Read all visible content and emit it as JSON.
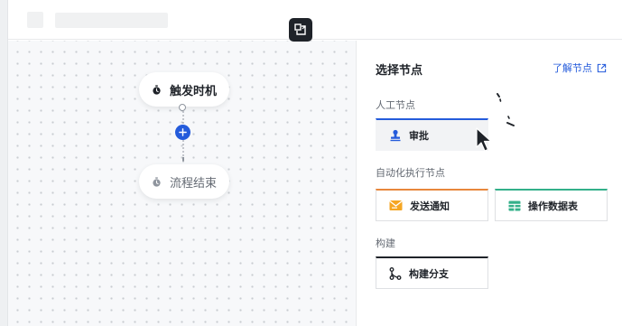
{
  "canvas": {
    "trigger_node": {
      "label": "触发时机",
      "icon": "stopwatch-icon"
    },
    "end_node": {
      "label": "流程结束",
      "icon": "stopwatch-icon"
    },
    "add_button": {
      "icon": "plus-icon"
    }
  },
  "topbar": {
    "expand_icon": "collapse-expand-icon"
  },
  "panel": {
    "title": "选择节点",
    "learn_link": "了解节点",
    "sections": {
      "manual": {
        "title": "人工节点",
        "items": [
          {
            "label": "审批",
            "icon": "stamp-icon",
            "accent": "#245bdb"
          }
        ]
      },
      "automation": {
        "title": "自动化执行节点",
        "items": [
          {
            "label": "发送通知",
            "icon": "mail-notify-icon",
            "accent": "#e8873c"
          },
          {
            "label": "操作数据表",
            "icon": "table-icon",
            "accent": "#33b08a"
          }
        ]
      },
      "build": {
        "title": "构建",
        "items": [
          {
            "label": "构建分支",
            "icon": "branch-icon",
            "accent": "#1f2329"
          }
        ]
      }
    }
  },
  "colors": {
    "primary": "#245bdb",
    "canvas_bg": "#f7f8fa",
    "text": "#1f2329",
    "muted": "#646a73"
  }
}
